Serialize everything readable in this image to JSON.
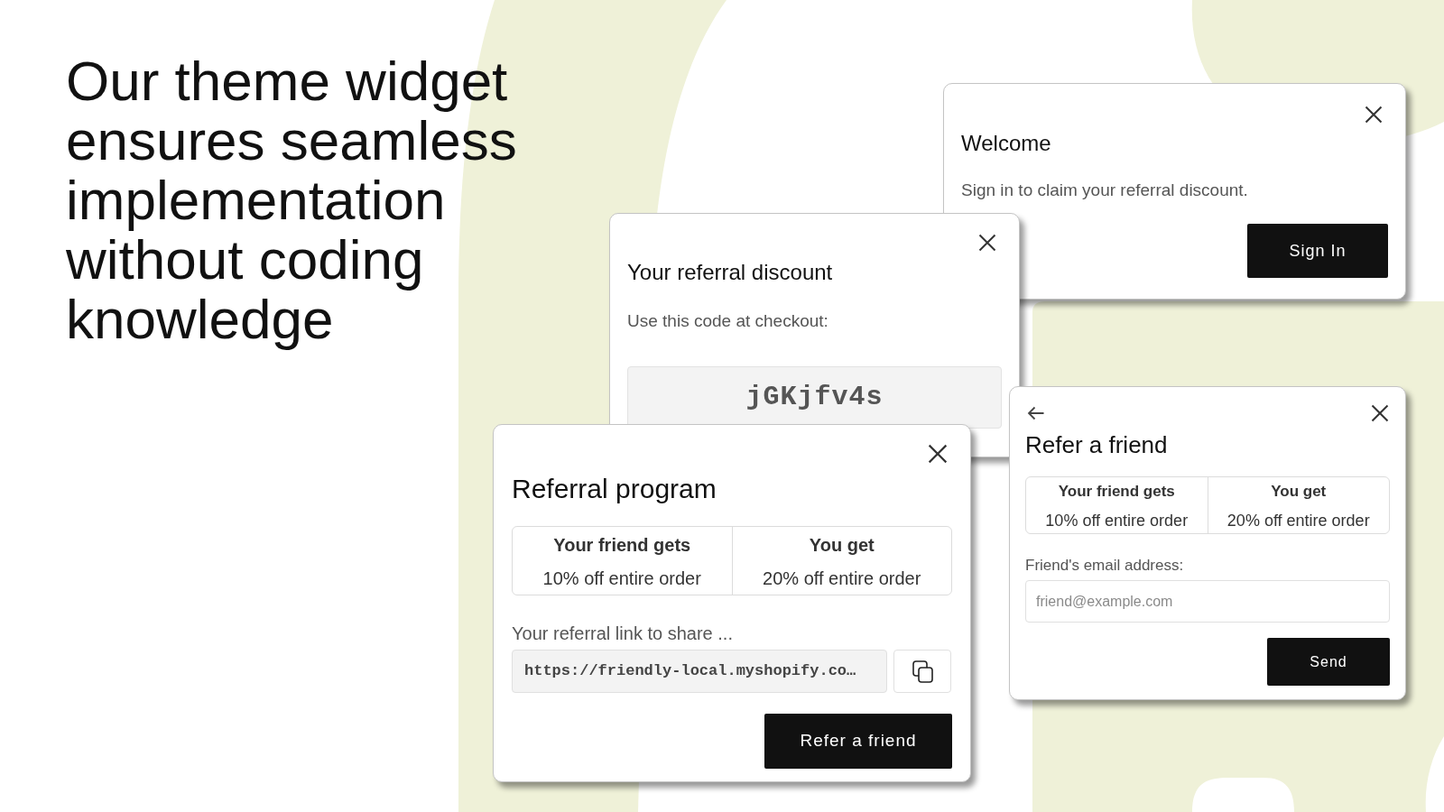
{
  "headline": "Our theme widget ensures seamless implementation without coding knowledge",
  "welcome_card": {
    "title": "Welcome",
    "message": "Sign in to claim your referral discount.",
    "button": "Sign In"
  },
  "discount_card": {
    "title": "Your referral discount",
    "message": "Use this code at checkout:",
    "code": "jGKjfv4s"
  },
  "program_card": {
    "title": "Referral program",
    "rewards": [
      {
        "heading": "Your friend gets",
        "value": "10% off entire order"
      },
      {
        "heading": "You get",
        "value": "20% off entire order"
      }
    ],
    "link_label": "Your referral link to share ...",
    "link_field": {
      "value": "https://friendly-local.myshopify.co…"
    },
    "button": "Refer a friend"
  },
  "refer_card": {
    "title": "Refer a friend",
    "rewards": [
      {
        "heading": "Your friend gets",
        "value": "10% off entire order"
      },
      {
        "heading": "You get",
        "value": "20% off entire order"
      }
    ],
    "email_label": "Friend's email address:",
    "email_field": {
      "placeholder": "friend@example.com"
    },
    "button": "Send"
  }
}
